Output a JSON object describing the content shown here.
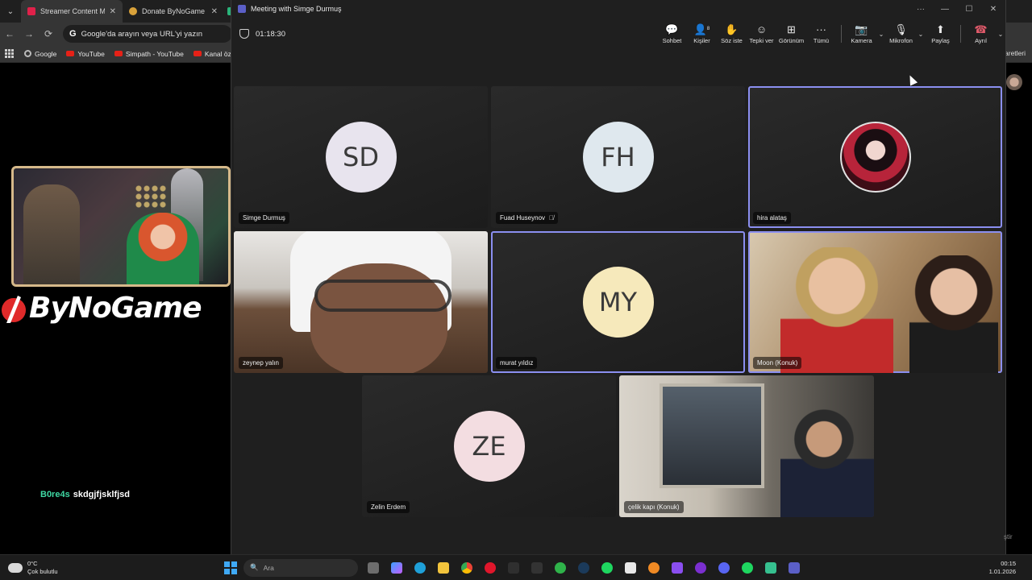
{
  "browser": {
    "tabs": [
      {
        "label": "Streamer Content Ma",
        "favicon": "red"
      },
      {
        "label": "Donate ByNoGame -",
        "favicon": "gold"
      }
    ],
    "omnibox_placeholder": "Google'da arayın veya URL'yi yazın",
    "bookmarks": [
      "Google",
      "YouTube",
      "Simpath - YouTube",
      "Kanal öze"
    ],
    "right_bookmark": "aretleri"
  },
  "stream": {
    "brand": "ByNoGame",
    "chat": {
      "user": "B0re4s",
      "message": "skdgjfjsklfjsd"
    }
  },
  "teams": {
    "window_title": "Meeting with Simge Durmuş",
    "timer": "01:18:30",
    "toolbar": {
      "chat": "Sohbet",
      "people": "Kişiler",
      "people_count": "8",
      "raise_hand": "Söz iste",
      "react": "Tepki ver",
      "view": "Görünüm",
      "more": "Tümü",
      "camera": "Kamera",
      "mic": "Mikrofon",
      "share": "Paylaş",
      "leave": "Ayrıl"
    },
    "participants": [
      {
        "name": "Simge Durmuş",
        "initials": "SD"
      },
      {
        "name": "Fuad Huseynov",
        "initials": "FH",
        "muted": true
      },
      {
        "name": "hira alataş",
        "speaking": true
      },
      {
        "name": "zeynep yalın"
      },
      {
        "name": "murat yıldız",
        "initials": "MY",
        "speaking": true
      },
      {
        "name": "Moon (Konuk)",
        "speaking": true
      },
      {
        "name": "Zelin Erdem",
        "initials": "ZE"
      },
      {
        "name": "çelik kapı (Konuk)"
      }
    ]
  },
  "right_partial_text": "ştir",
  "taskbar": {
    "weather_temp": "0°C",
    "weather_desc": "Çok bulutlu",
    "search_placeholder": "Ara",
    "time": "00:15",
    "date": "1.01.2026"
  }
}
